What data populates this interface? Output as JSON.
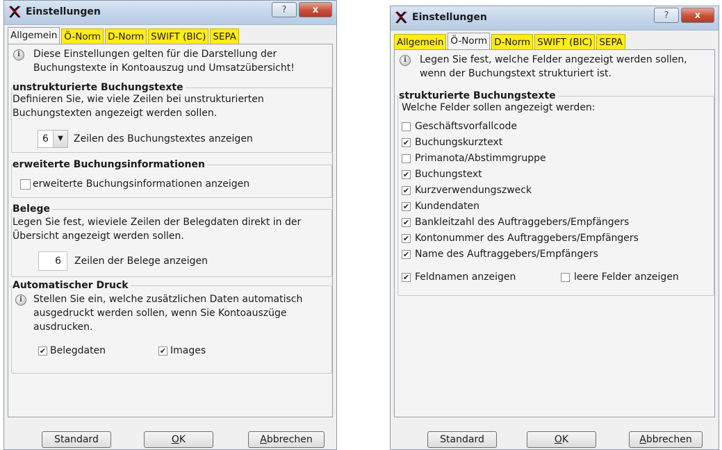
{
  "left_dialog": {
    "title": "Einstellungen",
    "help_glyph": "?",
    "close_glyph": "x",
    "tabs": [
      {
        "label": "Allgemein",
        "active": true
      },
      {
        "label": "Ö-Norm",
        "active": false
      },
      {
        "label": "D-Norm",
        "active": false
      },
      {
        "label": "SWIFT (BIC)",
        "active": false
      },
      {
        "label": "SEPA",
        "active": false
      }
    ],
    "info_line1": "Diese Einstellungen gelten für die Darstellung der",
    "info_line2": "Buchungstexte in Kontoauszug und Umsatzübersicht!",
    "unstructured": {
      "title": "unstrukturierte Buchungstexte",
      "desc_line1": "Definieren Sie, wie viele Zeilen bei unstrukturierten",
      "desc_line2": "Buchungstexten angezeigt werden sollen.",
      "lines_value": "6",
      "lines_label": "Zeilen des Buchungstextes anzeigen"
    },
    "extended": {
      "title": "erweiterte Buchungsinformationen",
      "checkbox_label": "erweiterte Buchungsinformationen anzeigen",
      "checked": false
    },
    "belege": {
      "title": "Belege",
      "desc_line1": "Legen Sie fest, wieviele Zeilen der Belegdaten direkt in der",
      "desc_line2": "Übersicht angezeigt werden sollen.",
      "value": "6",
      "label": "Zeilen der Belege anzeigen"
    },
    "autoprint": {
      "title": "Automatischer Druck",
      "desc_line1": "Stellen Sie ein, welche zusätzlichen Daten automatisch",
      "desc_line2": "ausgedruckt werden sollen, wenn Sie Kontoauszüge",
      "desc_line3": "ausdrucken.",
      "belegdaten_label": "Belegdaten",
      "belegdaten_checked": true,
      "images_label": "Images",
      "images_checked": true
    },
    "buttons": {
      "standard": "Standard",
      "ok_mnemonic": "O",
      "ok_rest": "K",
      "cancel_mnemonic": "A",
      "cancel_rest": "bbrechen"
    }
  },
  "right_dialog": {
    "title": "Einstellungen",
    "help_glyph": "?",
    "close_glyph": "x",
    "tabs": [
      {
        "label": "Allgemein",
        "active": false
      },
      {
        "label": "Ö-Norm",
        "active": true
      },
      {
        "label": "D-Norm",
        "active": false
      },
      {
        "label": "SWIFT (BIC)",
        "active": false
      },
      {
        "label": "SEPA",
        "active": false
      }
    ],
    "info_line1": "Legen Sie fest, welche Felder angezeigt werden sollen,",
    "info_line2": "wenn der Buchungstext strukturiert ist.",
    "structured": {
      "title": "strukturierte Buchungstexte",
      "subtitle": "Welche Felder sollen angezeigt werden:",
      "fields": [
        {
          "label": "Geschäftsvorfallcode",
          "checked": false
        },
        {
          "label": "Buchungskurztext",
          "checked": true
        },
        {
          "label": "Primanota/Abstimmgruppe",
          "checked": false
        },
        {
          "label": "Buchungstext",
          "checked": true
        },
        {
          "label": "Kurzverwendungszweck",
          "checked": true
        },
        {
          "label": "Kundendaten",
          "checked": true
        },
        {
          "label": "Bankleitzahl des Auftraggebers/Empfängers",
          "checked": true
        },
        {
          "label": "Kontonummer des Auftraggebers/Empfängers",
          "checked": true
        },
        {
          "label": "Name des Auftraggebers/Empfängers",
          "checked": true
        }
      ],
      "fieldnames_label": "Feldnamen anzeigen",
      "fieldnames_checked": true,
      "empty_fields_label": "leere Felder anzeigen",
      "empty_fields_checked": false
    },
    "buttons": {
      "standard": "Standard",
      "ok_mnemonic": "O",
      "ok_rest": "K",
      "cancel_mnemonic": "A",
      "cancel_rest": "bbrechen"
    }
  },
  "colors": {
    "tab_highlight": "#ffec1a",
    "logo": "#c8102e",
    "close_button": "#c8503a"
  },
  "icons": {
    "logo": "raiffeisen-cross-icon",
    "info": "info-icon",
    "check": "checkmark-icon"
  },
  "check_glyph": "✔"
}
